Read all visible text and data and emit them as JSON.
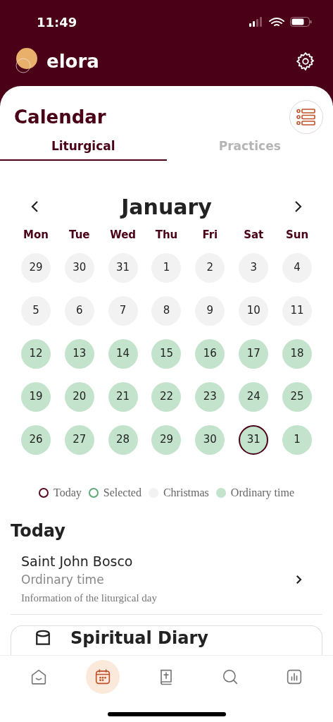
{
  "status_bar": {
    "time": "11:49"
  },
  "app_header": {
    "brand": "elora"
  },
  "calendar": {
    "title": "Calendar",
    "tabs": [
      {
        "label": "Liturgical",
        "selected": true
      },
      {
        "label": "Practices",
        "selected": false
      }
    ],
    "month": "January",
    "weekdays": [
      "Mon",
      "Tue",
      "Wed",
      "Thu",
      "Fri",
      "Sat",
      "Sun"
    ],
    "weeks": [
      [
        {
          "day": "29",
          "kind": "christmas",
          "today": false
        },
        {
          "day": "30",
          "kind": "christmas",
          "today": false
        },
        {
          "day": "31",
          "kind": "christmas",
          "today": false
        },
        {
          "day": "1",
          "kind": "christmas",
          "today": false
        },
        {
          "day": "2",
          "kind": "christmas",
          "today": false
        },
        {
          "day": "3",
          "kind": "christmas",
          "today": false
        },
        {
          "day": "4",
          "kind": "christmas",
          "today": false
        }
      ],
      [
        {
          "day": "5",
          "kind": "christmas",
          "today": false
        },
        {
          "day": "6",
          "kind": "christmas",
          "today": false
        },
        {
          "day": "7",
          "kind": "christmas",
          "today": false
        },
        {
          "day": "8",
          "kind": "christmas",
          "today": false
        },
        {
          "day": "9",
          "kind": "christmas",
          "today": false
        },
        {
          "day": "10",
          "kind": "christmas",
          "today": false
        },
        {
          "day": "11",
          "kind": "christmas",
          "today": false
        }
      ],
      [
        {
          "day": "12",
          "kind": "ordinary",
          "today": false
        },
        {
          "day": "13",
          "kind": "ordinary",
          "today": false
        },
        {
          "day": "14",
          "kind": "ordinary",
          "today": false
        },
        {
          "day": "15",
          "kind": "ordinary",
          "today": false
        },
        {
          "day": "16",
          "kind": "ordinary",
          "today": false
        },
        {
          "day": "17",
          "kind": "ordinary",
          "today": false
        },
        {
          "day": "18",
          "kind": "ordinary",
          "today": false
        }
      ],
      [
        {
          "day": "19",
          "kind": "ordinary",
          "today": false
        },
        {
          "day": "20",
          "kind": "ordinary",
          "today": false
        },
        {
          "day": "21",
          "kind": "ordinary",
          "today": false
        },
        {
          "day": "22",
          "kind": "ordinary",
          "today": false
        },
        {
          "day": "23",
          "kind": "ordinary",
          "today": false
        },
        {
          "day": "24",
          "kind": "ordinary",
          "today": false
        },
        {
          "day": "25",
          "kind": "ordinary",
          "today": false
        }
      ],
      [
        {
          "day": "26",
          "kind": "ordinary",
          "today": false
        },
        {
          "day": "27",
          "kind": "ordinary",
          "today": false
        },
        {
          "day": "28",
          "kind": "ordinary",
          "today": false
        },
        {
          "day": "29",
          "kind": "ordinary",
          "today": false
        },
        {
          "day": "30",
          "kind": "ordinary",
          "today": false
        },
        {
          "day": "31",
          "kind": "ordinary",
          "today": true
        },
        {
          "day": "1",
          "kind": "ordinary",
          "today": false
        }
      ]
    ],
    "legend": [
      {
        "label": "Today",
        "kind": "ring",
        "color": "#5a0a1e"
      },
      {
        "label": "Selected",
        "kind": "ring",
        "color": "#5fa878"
      },
      {
        "label": "Christmas",
        "kind": "dot",
        "color": "#f2f2f2"
      },
      {
        "label": "Ordinary time",
        "kind": "dot",
        "color": "#c4e3cc"
      }
    ]
  },
  "today": {
    "heading": "Today",
    "item": {
      "title": "Saint John Bosco",
      "season": "Ordinary time",
      "info": "Information of the liturgical day"
    },
    "card": {
      "title": "Spiritual Diary"
    }
  },
  "bottom_nav": [
    {
      "kind": "home",
      "selected": false
    },
    {
      "kind": "calendar",
      "selected": true
    },
    {
      "kind": "book",
      "selected": false
    },
    {
      "kind": "search",
      "selected": false
    },
    {
      "kind": "stats",
      "selected": false
    }
  ]
}
